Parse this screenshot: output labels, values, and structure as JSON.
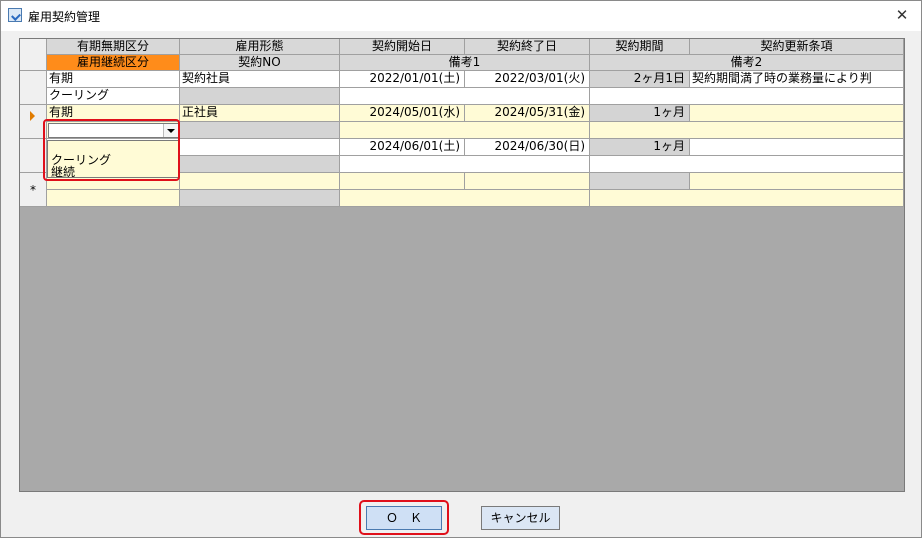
{
  "window": {
    "title": "雇用契約管理",
    "close_label": "✕"
  },
  "headers": {
    "row1": [
      "有期無期区分",
      "雇用形態",
      "契約開始日",
      "契約終了日",
      "契約期間",
      "契約更新条項"
    ],
    "row2": [
      "雇用継続区分",
      "契約NO",
      "備考1",
      "備考2"
    ]
  },
  "rows": [
    {
      "fixed": "有期",
      "type": "契約社員",
      "start": "2022/01/01(土)",
      "end": "2022/03/01(火)",
      "period": "2ヶ月1日",
      "renewal": "契約期間満了時の業務量により判",
      "continuation": "クーリング"
    },
    {
      "fixed": "有期",
      "type": "正社員",
      "start": "2024/05/01(水)",
      "end": "2024/05/31(金)",
      "period": "1ヶ月",
      "renewal": "",
      "continuation": ""
    },
    {
      "fixed": "",
      "type": "",
      "start": "2024/06/01(土)",
      "end": "2024/06/30(日)",
      "period": "1ヶ月",
      "renewal": "",
      "continuation": ""
    }
  ],
  "new_row_marker": "*",
  "dropdown": {
    "options": [
      "クーリング",
      "継続"
    ]
  },
  "buttons": {
    "ok": "Ｏ　Ｋ",
    "cancel": "キャンセル"
  },
  "colors": {
    "header_orange": "#ff8c1a",
    "highlight_red": "#e0101a",
    "row_yellow": "#fffbd6"
  }
}
